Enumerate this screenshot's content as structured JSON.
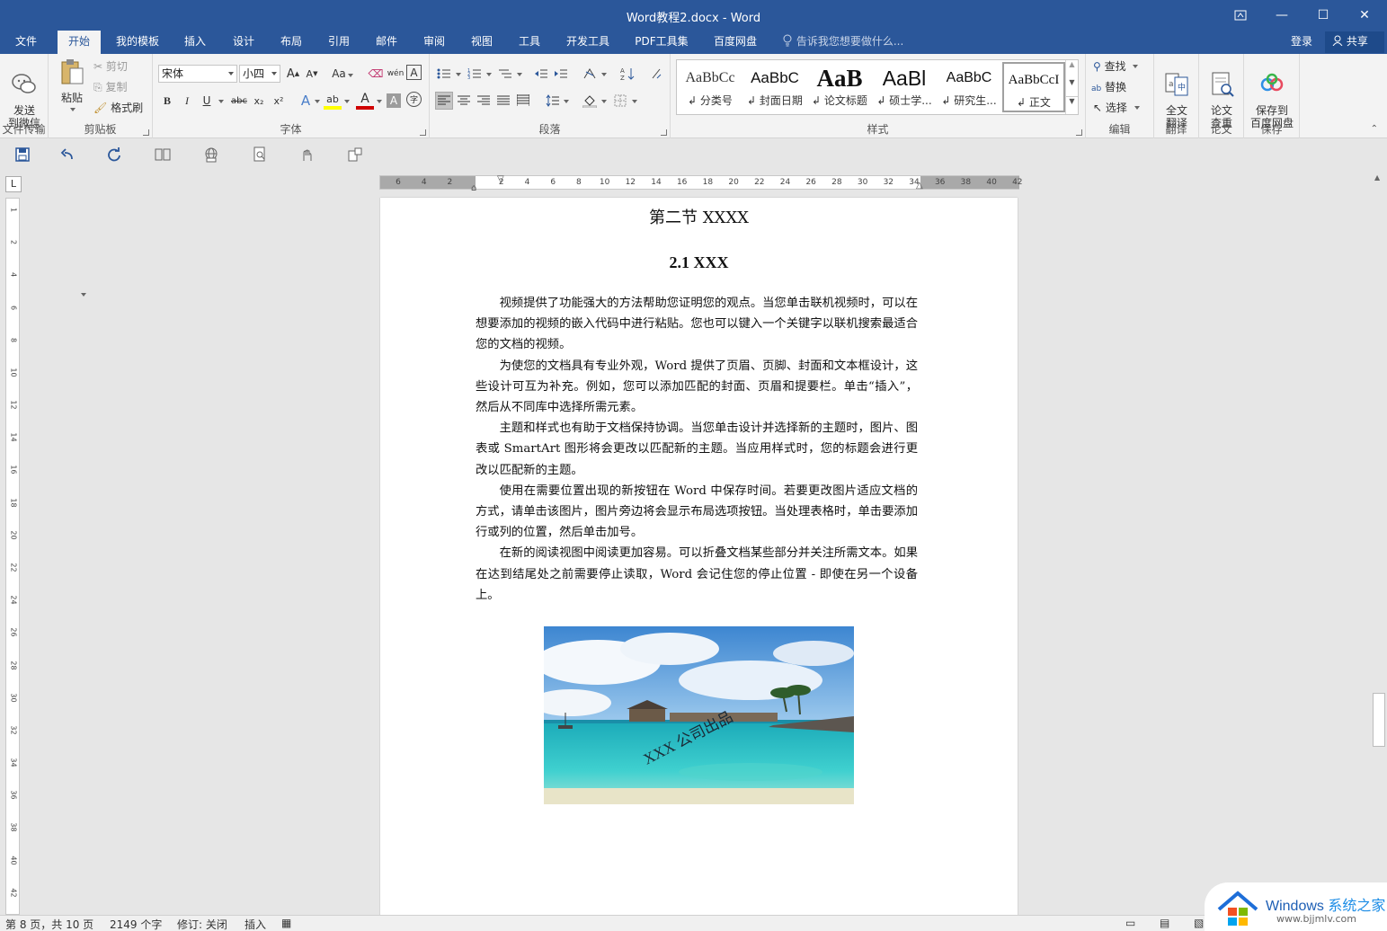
{
  "app": {
    "title": "Word教程2.docx - Word"
  },
  "window_controls": {
    "restore_ribbon": "⧉",
    "minimize": "—",
    "maximize": "☐",
    "close": "✕"
  },
  "tabs": [
    {
      "label": "文件"
    },
    {
      "label": "开始"
    },
    {
      "label": "我的模板"
    },
    {
      "label": "插入"
    },
    {
      "label": "设计"
    },
    {
      "label": "布局"
    },
    {
      "label": "引用"
    },
    {
      "label": "邮件"
    },
    {
      "label": "审阅"
    },
    {
      "label": "视图"
    },
    {
      "label": "工具"
    },
    {
      "label": "开发工具"
    },
    {
      "label": "PDF工具集"
    },
    {
      "label": "百度网盘"
    }
  ],
  "active_tab": "开始",
  "tell_me": {
    "placeholder": "告诉我您想要做什么..."
  },
  "account": {
    "signin": "登录",
    "share": "共享"
  },
  "ribbon": {
    "file_transfer": {
      "send_label": "发送\n到微信",
      "group": "文件传输"
    },
    "clipboard": {
      "paste": "粘贴",
      "cut": "剪切",
      "copy": "复制",
      "format_painter": "格式刷",
      "group": "剪贴板"
    },
    "font": {
      "name": "宋体",
      "size": "小四",
      "group": "字体",
      "grow": "A",
      "shrink": "A",
      "case": "Aa",
      "phonetic": "wén",
      "border": "A",
      "bold": "B",
      "italic": "I",
      "underline": "U",
      "strike": "abc",
      "sub": "x₂",
      "sup": "x²",
      "effects": "A",
      "highlight": "ab",
      "color": "A",
      "shade": "A",
      "circle": "字"
    },
    "paragraph": {
      "group": "段落"
    },
    "styles": {
      "group": "样式",
      "items": [
        {
          "preview": "AaBbCc",
          "name": "分类号"
        },
        {
          "preview": "AaBbC",
          "name": "封面日期"
        },
        {
          "preview": "AaB",
          "name": "论文标题"
        },
        {
          "preview": "AaBl",
          "name": "硕士学..."
        },
        {
          "preview": "AaBbC",
          "name": "研究生..."
        },
        {
          "preview": "AaBbCcI",
          "name": "正文"
        }
      ]
    },
    "editing": {
      "find": "查找",
      "replace": "替换",
      "select": "选择",
      "group": "编辑"
    },
    "translate": {
      "full": "全文\n翻译",
      "group": "翻译"
    },
    "paper": {
      "check": "论文\n查重",
      "group": "论文"
    },
    "save": {
      "baidu": "保存到\n百度网盘",
      "group": "保存"
    }
  },
  "ruler": {
    "horizontal_ticks": [
      "6",
      "4",
      "2",
      "",
      "2",
      "4",
      "6",
      "8",
      "10",
      "12",
      "14",
      "16",
      "18",
      "20",
      "22",
      "24",
      "26",
      "28",
      "30",
      "32",
      "34",
      "36",
      "38",
      "40",
      "42"
    ],
    "vertical_ticks": [
      "1",
      "2",
      "4",
      "6",
      "8",
      "10",
      "12",
      "14",
      "16",
      "18",
      "20",
      "22",
      "24",
      "26",
      "28",
      "30",
      "32",
      "34",
      "36",
      "38",
      "40",
      "42"
    ],
    "tab_selector": "L"
  },
  "document": {
    "section_title": "第二节  XXXX",
    "heading": "2.1 XXX",
    "paragraphs": [
      "视频提供了功能强大的方法帮助您证明您的观点。当您单击联机视频时，可以在想要添加的视频的嵌入代码中进行粘贴。您也可以键入一个关键字以联机搜索最适合您的文档的视频。",
      "为使您的文档具有专业外观，Word 提供了页眉、页脚、封面和文本框设计，这些设计可互为补充。例如，您可以添加匹配的封面、页眉和提要栏。单击“插入”，然后从不同库中选择所需元素。",
      "主题和样式也有助于文档保持协调。当您单击设计并选择新的主题时，图片、图表或 SmartArt 图形将会更改以匹配新的主题。当应用样式时，您的标题会进行更改以匹配新的主题。",
      "使用在需要位置出现的新按钮在 Word 中保存时间。若要更改图片适应文档的方式，请单击该图片，图片旁边将会显示布局选项按钮。当处理表格时，单击要添加行或列的位置，然后单击加号。",
      "在新的阅读视图中阅读更加容易。可以折叠文档某些部分并关注所需文本。如果在达到结尾处之前需要停止读取，Word 会记住您的停止位置 - 即使在另一个设备上。"
    ],
    "image_watermark": "XXX 公司出品"
  },
  "status": {
    "page": "第 8 页，共 10 页",
    "words": "2149 个字",
    "track_changes": "修订: 关闭",
    "insert_mode": "插入"
  },
  "badge": {
    "brand": "Windows",
    "brand_cn": "系统之家",
    "url": "www.bjjmlv.com"
  },
  "colors": {
    "accent": "#2b579a",
    "ribbon_bg": "#f3f3f3",
    "font_color_red": "#d00000",
    "highlight_yellow": "#ffff00"
  }
}
